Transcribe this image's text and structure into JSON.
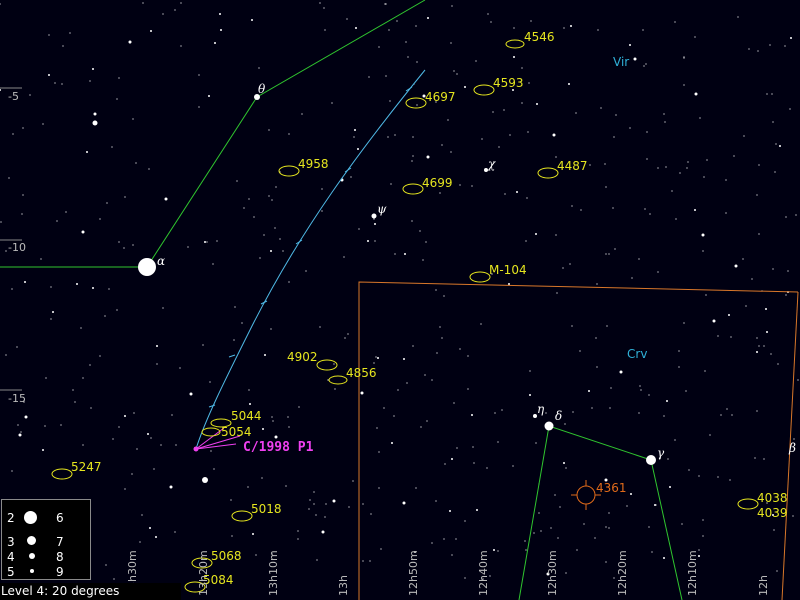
{
  "colors": {
    "background": "#000012",
    "constellation_lines": "#2fc52f",
    "boundaries": "#d9772a",
    "comet_path": "#4fb9e6",
    "galaxy": "#e5e51f",
    "comet_label": "#f040f0",
    "constellation_name": "#2fb0d8",
    "planetary_nebula": "#e06a1a",
    "text": "#ffffff"
  },
  "constellations": [
    {
      "name": "Vir"
    },
    {
      "name": "Crv"
    }
  ],
  "stars_named": [
    {
      "label": "θ"
    },
    {
      "label": "α"
    },
    {
      "label": "χ"
    },
    {
      "label": "ψ"
    },
    {
      "label": "η"
    },
    {
      "label": "δ"
    },
    {
      "label": "γ"
    },
    {
      "label": "β"
    }
  ],
  "galaxies": [
    {
      "label": "4546"
    },
    {
      "label": "4593"
    },
    {
      "label": "4697"
    },
    {
      "label": "4958"
    },
    {
      "label": "4487"
    },
    {
      "label": "4699"
    },
    {
      "label": "M-104"
    },
    {
      "label": "4902"
    },
    {
      "label": "4856"
    },
    {
      "label": "5044"
    },
    {
      "label": "5054"
    },
    {
      "label": "5247"
    },
    {
      "label": "5018"
    },
    {
      "label": "5068"
    },
    {
      "label": "5084"
    },
    {
      "label": "4038"
    },
    {
      "label": "4039"
    }
  ],
  "planetary_nebula": {
    "label": "4361"
  },
  "comet": {
    "label": "C/1998 P1"
  },
  "dec_labels": [
    "-5",
    "-10",
    "-15"
  ],
  "ra_labels": [
    "13h30m",
    "13h20m",
    "13h10m",
    "13h",
    "12h50m",
    "12h40m",
    "12h30m",
    "12h20m",
    "12h10m",
    "12h"
  ],
  "legend": {
    "magnitudes": [
      "2",
      "3",
      "4",
      "5",
      "6",
      "7",
      "8",
      "9"
    ]
  },
  "status": "Level 4: 20 degrees"
}
